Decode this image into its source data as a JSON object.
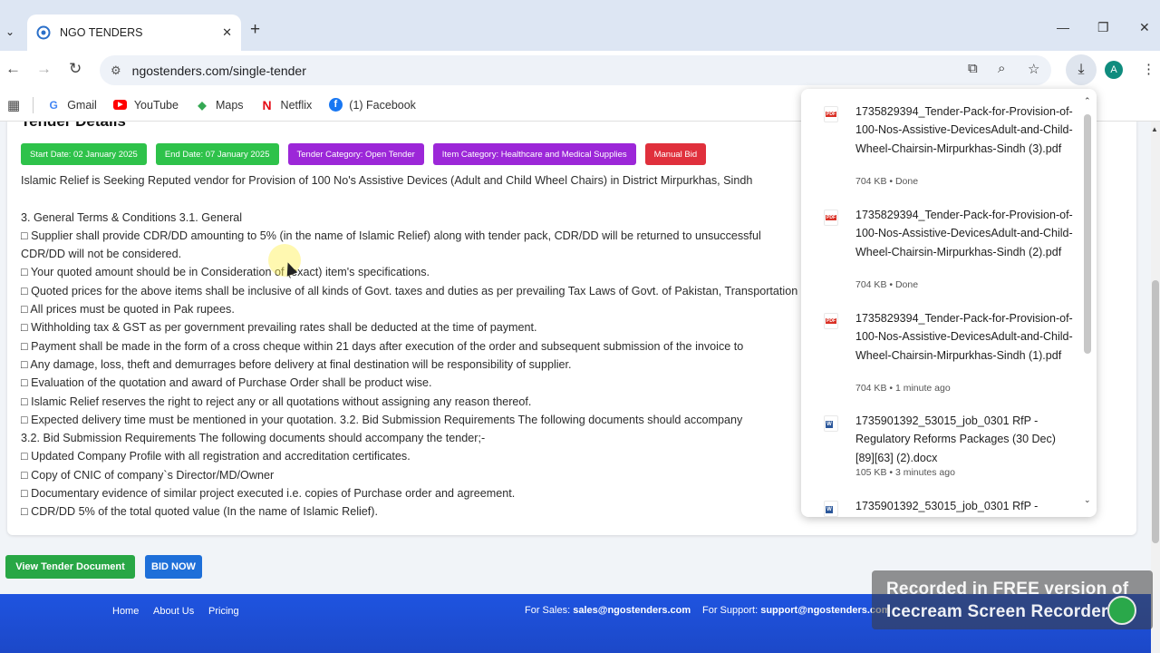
{
  "browser": {
    "tab_title": "NGO TENDERS",
    "url": "ngostenders.com/single-tender",
    "avatar_letter": "A",
    "bookmarks": [
      {
        "label": "Gmail",
        "icon": "google-icon"
      },
      {
        "label": "YouTube",
        "icon": "youtube-icon"
      },
      {
        "label": "Maps",
        "icon": "maps-icon"
      },
      {
        "label": "Netflix",
        "icon": "netflix-icon"
      },
      {
        "label": "(1) Facebook",
        "icon": "facebook-icon"
      }
    ]
  },
  "tender": {
    "heading": "Tender Details",
    "badges": [
      {
        "label": "Start Date: 02 January 2025",
        "color": "#2ec24a"
      },
      {
        "label": "End Date: 07 January 2025",
        "color": "#2ec24a"
      },
      {
        "label": "Tender Category: Open Tender",
        "color": "#9c27d8"
      },
      {
        "label": "Item Category: Healthcare and Medical Supplies",
        "color": "#9c27d8"
      },
      {
        "label": "Manual Bid",
        "color": "#e0303c"
      }
    ],
    "description": "Islamic Relief is Seeking Reputed vendor for Provision of 100 No's Assistive Devices (Adult and Child Wheel Chairs) in District Mirpurkhas, Sindh",
    "terms": [
      "3. General Terms & Conditions 3.1. General",
      "□ Supplier shall provide CDR/DD amounting to 5% (in the name of Islamic Relief) along with tender pack, CDR/DD will be returned to unsuccessful",
      "CDR/DD will not be considered.",
      " □ Your quoted amount should be in Consideration of (exact) item's specifications.",
      "□ Quoted prices for the above items shall be inclusive of all kinds of Govt. taxes and duties as per prevailing Tax Laws of Govt. of Pakistan, Transportation ...                                                                                    any)",
      "□ All prices must be quoted in Pak rupees.",
      "□ Withholding tax & GST as per government prevailing rates shall be deducted at the time of payment.",
      " □ Payment shall be made in the form of a cross cheque within 21 days after execution of the order and subsequent submission of the invoice to",
      "□ Any damage, loss, theft and demurrages before delivery at final destination will be responsibility of supplier.",
      " □ Evaluation of the quotation and award of Purchase Order shall be product wise.",
      "□ Islamic Relief reserves the right to reject any or all quotations without assigning any reason thereof.",
      "□ Expected delivery time must be mentioned in your quotation. 3.2. Bid Submission Requirements The following documents should accompany",
      "3.2. Bid Submission Requirements The following documents should accompany the tender;-",
      "□ Updated Company Profile with all registration and accreditation certificates.",
      "□ Copy of CNIC of company`s Director/MD/Owner",
      "□ Documentary evidence of similar project executed i.e. copies of Purchase order and agreement.",
      "□ CDR/DD 5% of the total quoted value (In the name of Islamic Relief)."
    ],
    "view_button": "View Tender Document",
    "bid_button": "BID NOW"
  },
  "footer": {
    "links": [
      "Home",
      "About Us",
      "Pricing"
    ],
    "sales_label": "For Sales:",
    "sales_email": "sales@ngostenders.com",
    "support_label": "For Support:",
    "support_email": "support@ngostenders.com"
  },
  "downloads": [
    {
      "type": "pdf",
      "name": "1735829394_Tender-Pack-for-Provision-of-100-Nos-Assistive-DevicesAdult-and-Child-Wheel-Chairsin-Mirpurkhas-Sindh (3).pdf",
      "meta": "704 KB • Done"
    },
    {
      "type": "pdf",
      "name": "1735829394_Tender-Pack-for-Provision-of-100-Nos-Assistive-DevicesAdult-and-Child-Wheel-Chairsin-Mirpurkhas-Sindh (2).pdf",
      "meta": "704 KB • Done"
    },
    {
      "type": "pdf",
      "name": "1735829394_Tender-Pack-for-Provision-of-100-Nos-Assistive-DevicesAdult-and-Child-Wheel-Chairsin-Mirpurkhas-Sindh (1).pdf",
      "meta": "704 KB • 1 minute ago"
    },
    {
      "type": "doc",
      "name": "1735901392_53015_job_0301 RfP - Regulatory Reforms Packages (30 Dec)[89][63] (2).docx",
      "meta": "105 KB • 3 minutes ago"
    },
    {
      "type": "doc",
      "name": "1735901392_53015_job_0301 RfP -",
      "meta": ""
    }
  ],
  "watermark": {
    "line1": "Recorded in FREE version of",
    "line2": "Icecream Screen Recorder"
  },
  "colors": {
    "accent_green": "#28a745",
    "accent_blue": "#1e6fd9",
    "footer_blue": "#1f54e0"
  }
}
